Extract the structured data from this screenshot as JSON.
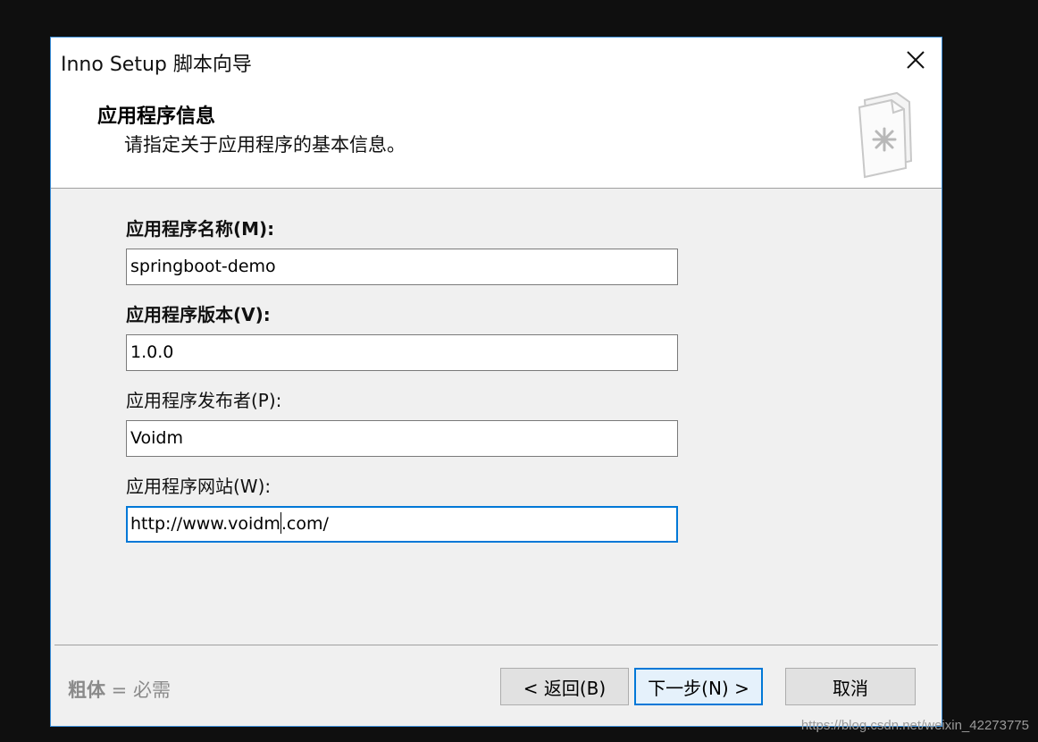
{
  "window": {
    "title": "Inno Setup 脚本向导",
    "close_glyph": "✕"
  },
  "header": {
    "title": "应用程序信息",
    "subtitle": "请指定关于应用程序的基本信息。",
    "icon": "document-star-icon"
  },
  "fields": [
    {
      "label": "应用程序名称(M):",
      "value": "springboot-demo",
      "required": true
    },
    {
      "label": "应用程序版本(V):",
      "value": "1.0.0",
      "required": true
    },
    {
      "label": "应用程序发布者(P):",
      "value": "Voidm",
      "required": false
    },
    {
      "label": "应用程序网站(W):",
      "value_before_caret": "http://www.voidm",
      "value_after_caret": ".com/",
      "required": false,
      "focused": true
    }
  ],
  "footer": {
    "legend_bold": "粗体",
    "legend_rest": " = 必需",
    "back_label": "< 返回(B)",
    "next_label": "下一步(N) >",
    "cancel_label": "取消"
  },
  "watermark": "https://blog.csdn.net/weixin_42273775",
  "colors": {
    "accent": "#0078d7",
    "window_bg": "#f0f0f0",
    "screen_bg": "#0f0f0f"
  }
}
